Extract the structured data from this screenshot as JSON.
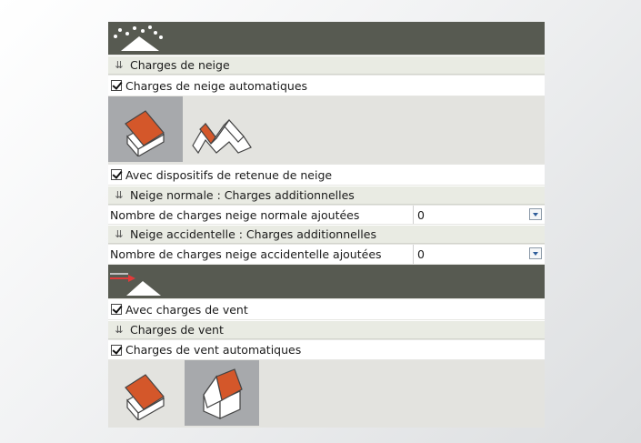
{
  "snow": {
    "section_title": "Charges de neige",
    "auto_label": "Charges de neige automatiques",
    "retention_label": "Avec dispositifs de retenue de neige",
    "normal_section": "Neige normale : Charges additionnelles",
    "normal_prop_label": "Nombre de charges neige normale ajoutées",
    "normal_prop_value": "0",
    "accidental_section": "Neige accidentelle : Charges additionnelles",
    "accidental_prop_label": "Nombre de charges neige accidentelle ajoutées",
    "accidental_prop_value": "0",
    "roof_options": [
      "single-pitch-roof-icon",
      "multi-pitch-roof-icon"
    ],
    "selected_roof": "single-pitch-roof-icon"
  },
  "wind": {
    "enable_label": "Avec charges de vent",
    "section_title": "Charges de vent",
    "auto_label": "Charges de vent automatiques",
    "roof_options": [
      "single-pitch-roof-icon",
      "gable-roof-icon"
    ],
    "selected_roof": "gable-roof-icon"
  },
  "colors": {
    "header_bar": "#575a51",
    "roof_orange": "#d4572a",
    "selected_tile": "#a7a9ac",
    "wind_arrow": "#e03a3a"
  }
}
